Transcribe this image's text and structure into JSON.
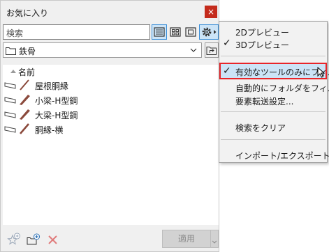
{
  "palette": {
    "title": "お気に入り",
    "close_glyph": "×",
    "search_placeholder": "検索",
    "folder": "鉄骨",
    "column_header": "名前",
    "items": [
      {
        "label": "屋根胴縁"
      },
      {
        "label": "小梁-H型鋼"
      },
      {
        "label": "大梁-H型鋼"
      },
      {
        "label": "胴縁-横"
      }
    ],
    "apply_label": "適用",
    "icons": [
      "list-view-icon",
      "grid-view-icon",
      "preview-view-icon",
      "gear-icon",
      "folder-icon",
      "folder-up-icon",
      "new-favorite-icon",
      "new-folder-icon",
      "delete-icon"
    ]
  },
  "menu": {
    "items": {
      "preview2d": {
        "label": "2Dプレビュー",
        "checked": false
      },
      "preview3d": {
        "label": "3Dプレビュー",
        "checked": true
      },
      "filter_active": {
        "label": "有効なツールのみにフィルタ",
        "checked": true
      },
      "auto_filter": {
        "label": "自動的にフォルダをフィルタ",
        "checked": false
      },
      "transfer": {
        "label": "要素転送設定..."
      },
      "clear_search": {
        "label": "検索をクリア"
      },
      "import_export": {
        "label": "インポート/エクスポート..."
      }
    }
  },
  "colors": {
    "highlight": "#cce4f7",
    "focus_border": "#e8252a",
    "close": "#c42b1c",
    "beam": "#8b4a3c"
  }
}
